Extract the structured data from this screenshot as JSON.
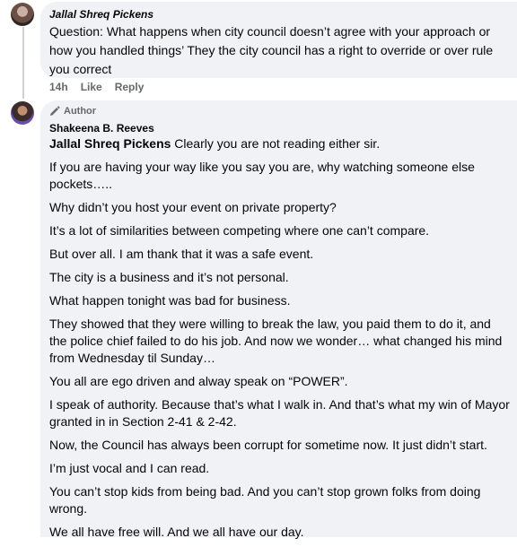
{
  "comment1": {
    "author": "Jallal Shreq Pickens",
    "text": "Question: What happens when city council doesn’t agree with your approach or how you handled things’ They the city council has a right to override or over rule you correct",
    "time": "14h",
    "like_label": "Like",
    "reply_label": "Reply"
  },
  "reply": {
    "badge": "Author",
    "author": "Shakeena B. Reeves",
    "mention": "Jallal Shreq Pickens",
    "first_line": " Clearly you are not reading either sir.",
    "paragraphs": [
      "If you are having your way like you say you are, why watching someone else pockets…..",
      "Why didn’t you host your event on private property?",
      "It’s a lot of similarities between competing where one can’t compare.",
      "But over all. I am thank that it was a safe event.",
      "The city is a business and it’s not personal.",
      "What happen tonight was bad for business.",
      "They showed that they were willing to break the law, you paid them to do it, and the police chief failed to do his job. And now we wonder… what changed his mind from Wednesday til Sunday…",
      "You all are ego driven and alway speak on “POWER”.",
      "I speak of authority. Because that’s what I walk in. And that’s what my win of Mayor granted in in Section 2-41 & 2-42.",
      "Now, the Council has always been corrupt for sometime now. It just didn’t start.",
      "I’m just vocal and I can read.",
      "You can’t stop kids from being bad. And you can’t stop grown folks from doing wrong.",
      "We all have free will. And we all have our day."
    ]
  }
}
